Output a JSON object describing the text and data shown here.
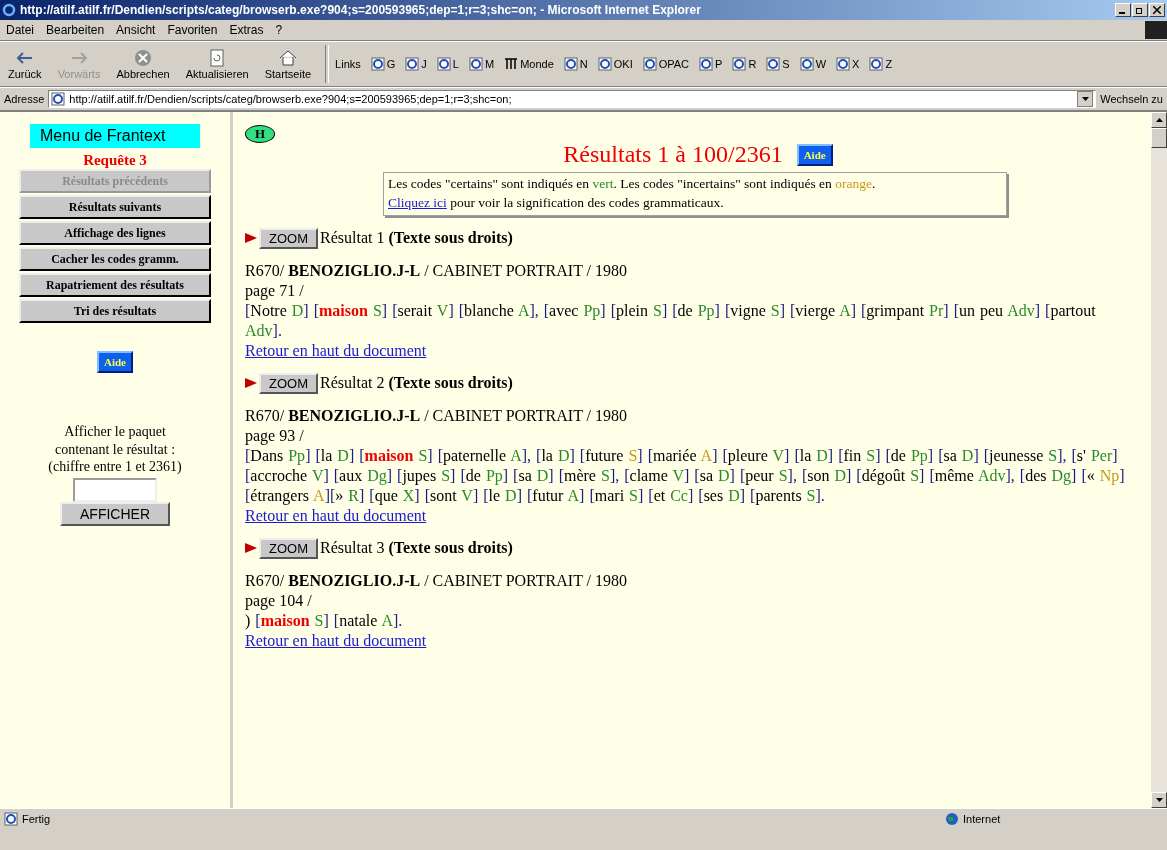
{
  "window": {
    "title": "http://atilf.atilf.fr/Dendien/scripts/categ/browserb.exe?904;s=200593965;dep=1;r=3;shc=on; - Microsoft Internet Explorer"
  },
  "menu": [
    "Datei",
    "Bearbeiten",
    "Ansicht",
    "Favoriten",
    "Extras",
    "?"
  ],
  "toolbar": [
    {
      "kind": "back",
      "label": "Zurück",
      "disabled": false
    },
    {
      "kind": "forward",
      "label": "Vorwärts",
      "disabled": true
    },
    {
      "kind": "stop",
      "label": "Abbrechen",
      "disabled": false
    },
    {
      "kind": "refresh",
      "label": "Aktualisieren",
      "disabled": false
    },
    {
      "kind": "home",
      "label": "Startseite",
      "disabled": false
    }
  ],
  "links": {
    "label": "Links",
    "items": [
      {
        "kind": "page",
        "label": "G"
      },
      {
        "kind": "page",
        "label": "J"
      },
      {
        "kind": "page",
        "label": "L"
      },
      {
        "kind": "page",
        "label": "M"
      },
      {
        "kind": "monde",
        "label": "Monde"
      },
      {
        "kind": "page",
        "label": "N"
      },
      {
        "kind": "page",
        "label": "OKI"
      },
      {
        "kind": "page",
        "label": "OPAC"
      },
      {
        "kind": "page",
        "label": "P"
      },
      {
        "kind": "page",
        "label": "R"
      },
      {
        "kind": "page",
        "label": "S"
      },
      {
        "kind": "page",
        "label": "W"
      },
      {
        "kind": "page",
        "label": "X"
      },
      {
        "kind": "page",
        "label": "Z"
      }
    ]
  },
  "address": {
    "label": "Adresse",
    "value": "http://atilf.atilf.fr/Dendien/scripts/categ/browserb.exe?904;s=200593965;dep=1;r=3;shc=on;",
    "go": "Wechseln zu"
  },
  "sidebar": {
    "title": "Menu de Frantext",
    "query": "Requête 3",
    "buttons": [
      {
        "label": "Résultats précédents",
        "disabled": true
      },
      {
        "label": "Résultats suivants",
        "disabled": false
      },
      {
        "label": "Affichage des lignes",
        "disabled": false
      },
      {
        "label": "Cacher les codes gramm.",
        "disabled": false
      },
      {
        "label": "Rapatriement des résultats",
        "disabled": false
      },
      {
        "label": "Tri des résultats",
        "disabled": false
      }
    ],
    "help": "Aide",
    "packet_text": "Afficher le paquet contenant le résultat : (chiffre entre 1 et 2361)",
    "packet_button": "AFFICHER"
  },
  "main": {
    "home": "H",
    "heading": "Résultats 1 à 100/2361",
    "help": "Aide",
    "legend": {
      "prefix": "Les codes \"certains\" sont indiqués en ",
      "certain": "vert",
      "middle": ". Les codes \"incertains\" sont indiqués en ",
      "uncertain": "orange",
      "suffix": ".",
      "link": "Cliquez ici",
      "link_suffix": " pour voir la signification des codes grammaticaux."
    },
    "results": [
      {
        "zoom": "ZOOM",
        "label": "Résultat 1",
        "rights": "(Texte sous droits)",
        "ref": "R670/",
        "author": "BENOZIGLIO.J-L",
        "rest": " / CABINET PORTRAIT / 1980",
        "page": "page 71 /",
        "tokens": [
          {
            "pre": "[",
            "word": "Notre",
            "code": " D",
            "uncertain": false,
            "hit": false,
            "post": "] "
          },
          {
            "pre": "[",
            "word": "maison",
            "code": " S",
            "uncertain": false,
            "hit": true,
            "post": "] "
          },
          {
            "pre": "[",
            "word": "serait",
            "code": " V",
            "uncertain": false,
            "hit": false,
            "post": "] "
          },
          {
            "pre": "[",
            "word": "blanche",
            "code": " A",
            "uncertain": false,
            "hit": false,
            "post": "], "
          },
          {
            "pre": "[",
            "word": "avec",
            "code": " Pp",
            "uncertain": false,
            "hit": false,
            "post": "] "
          },
          {
            "pre": "[",
            "word": "plein",
            "code": " S",
            "uncertain": false,
            "hit": false,
            "post": "] "
          },
          {
            "pre": "[",
            "word": "de",
            "code": " Pp",
            "uncertain": false,
            "hit": false,
            "post": "] "
          },
          {
            "pre": "[",
            "word": "vigne",
            "code": " S",
            "uncertain": false,
            "hit": false,
            "post": "] "
          },
          {
            "pre": "[",
            "word": "vierge",
            "code": " A",
            "uncertain": false,
            "hit": false,
            "post": "] "
          },
          {
            "pre": "[",
            "word": "grimpant",
            "code": " Pr",
            "uncertain": false,
            "hit": false,
            "post": "] "
          },
          {
            "pre": "[",
            "word": "un peu",
            "code": " Adv",
            "uncertain": false,
            "hit": false,
            "post": "] "
          },
          {
            "pre": "[",
            "word": "partout",
            "code": " Adv",
            "uncertain": false,
            "hit": false,
            "post": "]."
          }
        ],
        "back": "Retour en haut du document"
      },
      {
        "zoom": "ZOOM",
        "label": "Résultat 2",
        "rights": "(Texte sous droits)",
        "ref": "R670/",
        "author": "BENOZIGLIO.J-L",
        "rest": " / CABINET PORTRAIT / 1980",
        "page": "page 93 /",
        "tokens": [
          {
            "pre": "[",
            "word": "Dans",
            "code": " Pp",
            "uncertain": false,
            "hit": false,
            "post": "] "
          },
          {
            "pre": "[",
            "word": "la",
            "code": " D",
            "uncertain": false,
            "hit": false,
            "post": "] "
          },
          {
            "pre": "[",
            "word": "maison",
            "code": " S",
            "uncertain": false,
            "hit": true,
            "post": "] "
          },
          {
            "pre": "[",
            "word": "paternelle",
            "code": " A",
            "uncertain": false,
            "hit": false,
            "post": "], "
          },
          {
            "pre": "[",
            "word": "la",
            "code": " D",
            "uncertain": false,
            "hit": false,
            "post": "] "
          },
          {
            "pre": "[",
            "word": "future",
            "code": " S",
            "uncertain": true,
            "hit": false,
            "post": "] "
          },
          {
            "pre": "[",
            "word": "mariée",
            "code": " A",
            "uncertain": true,
            "hit": false,
            "post": "] "
          },
          {
            "pre": "[",
            "word": "pleure",
            "code": " V",
            "uncertain": false,
            "hit": false,
            "post": "] "
          },
          {
            "pre": "[",
            "word": "la",
            "code": " D",
            "uncertain": false,
            "hit": false,
            "post": "] "
          },
          {
            "pre": "[",
            "word": "fin",
            "code": " S",
            "uncertain": false,
            "hit": false,
            "post": "] "
          },
          {
            "pre": "[",
            "word": "de",
            "code": " Pp",
            "uncertain": false,
            "hit": false,
            "post": "] "
          },
          {
            "pre": "[",
            "word": "sa",
            "code": " D",
            "uncertain": false,
            "hit": false,
            "post": "] "
          },
          {
            "pre": "[",
            "word": "jeunesse",
            "code": " S",
            "uncertain": false,
            "hit": false,
            "post": "], "
          },
          {
            "pre": "[",
            "word": "s'",
            "code": " Per",
            "uncertain": false,
            "hit": false,
            "post": "]"
          },
          {
            "pre": "[",
            "word": "accroche",
            "code": " V",
            "uncertain": false,
            "hit": false,
            "post": "] "
          },
          {
            "pre": "[",
            "word": "aux",
            "code": " Dg",
            "uncertain": false,
            "hit": false,
            "post": "] "
          },
          {
            "pre": "[",
            "word": "jupes",
            "code": " S",
            "uncertain": false,
            "hit": false,
            "post": "] "
          },
          {
            "pre": "[",
            "word": "de",
            "code": " Pp",
            "uncertain": false,
            "hit": false,
            "post": "] "
          },
          {
            "pre": "[",
            "word": "sa",
            "code": " D",
            "uncertain": false,
            "hit": false,
            "post": "] "
          },
          {
            "pre": "[",
            "word": "mère",
            "code": " S",
            "uncertain": false,
            "hit": false,
            "post": "], "
          },
          {
            "pre": "[",
            "word": "clame",
            "code": " V",
            "uncertain": false,
            "hit": false,
            "post": "] "
          },
          {
            "pre": "[",
            "word": "sa",
            "code": " D",
            "uncertain": false,
            "hit": false,
            "post": "] "
          },
          {
            "pre": "[",
            "word": "peur",
            "code": " S",
            "uncertain": false,
            "hit": false,
            "post": "], "
          },
          {
            "pre": "[",
            "word": "son",
            "code": " D",
            "uncertain": false,
            "hit": false,
            "post": "] "
          },
          {
            "pre": "[",
            "word": "dégoût",
            "code": " S",
            "uncertain": false,
            "hit": false,
            "post": "] "
          },
          {
            "pre": "[",
            "word": "même",
            "code": " Adv",
            "uncertain": false,
            "hit": false,
            "post": "], "
          },
          {
            "pre": "[",
            "word": "des",
            "code": " Dg",
            "uncertain": false,
            "hit": false,
            "post": "] "
          },
          {
            "pre": "[",
            "word": "«",
            "code": " Np",
            "uncertain": true,
            "hit": false,
            "post": "]"
          },
          {
            "pre": "[",
            "word": "étrangers",
            "code": " A",
            "uncertain": true,
            "hit": false,
            "post": "]"
          },
          {
            "pre": "[",
            "word": "»",
            "code": " R",
            "uncertain": false,
            "hit": false,
            "post": "] "
          },
          {
            "pre": "[",
            "word": "que",
            "code": " X",
            "uncertain": false,
            "hit": false,
            "post": "] "
          },
          {
            "pre": "[",
            "word": "sont",
            "code": " V",
            "uncertain": false,
            "hit": false,
            "post": "] "
          },
          {
            "pre": "[",
            "word": "le",
            "code": " D",
            "uncertain": false,
            "hit": false,
            "post": "] "
          },
          {
            "pre": "[",
            "word": "futur",
            "code": " A",
            "uncertain": false,
            "hit": false,
            "post": "] "
          },
          {
            "pre": "[",
            "word": "mari",
            "code": " S",
            "uncertain": false,
            "hit": false,
            "post": "] "
          },
          {
            "pre": "[",
            "word": "et",
            "code": " Cc",
            "uncertain": false,
            "hit": false,
            "post": "] "
          },
          {
            "pre": "[",
            "word": "ses",
            "code": " D",
            "uncertain": false,
            "hit": false,
            "post": "] "
          },
          {
            "pre": "[",
            "word": "parents",
            "code": " S",
            "uncertain": false,
            "hit": false,
            "post": "]."
          }
        ],
        "back": "Retour en haut du document"
      },
      {
        "zoom": "ZOOM",
        "label": "Résultat 3",
        "rights": "(Texte sous droits)",
        "ref": "R670/",
        "author": "BENOZIGLIO.J-L",
        "rest": " / CABINET PORTRAIT / 1980",
        "page": "page 104 /",
        "lead": ") ",
        "tokens": [
          {
            "pre": "[",
            "word": "maison",
            "code": " S",
            "uncertain": false,
            "hit": true,
            "post": "] "
          },
          {
            "pre": "[",
            "word": "natale",
            "code": " A",
            "uncertain": false,
            "hit": false,
            "post": "]."
          }
        ],
        "back": "Retour en haut du document"
      }
    ]
  },
  "status_bar": {
    "text": "Fertig",
    "zone": "Internet"
  }
}
